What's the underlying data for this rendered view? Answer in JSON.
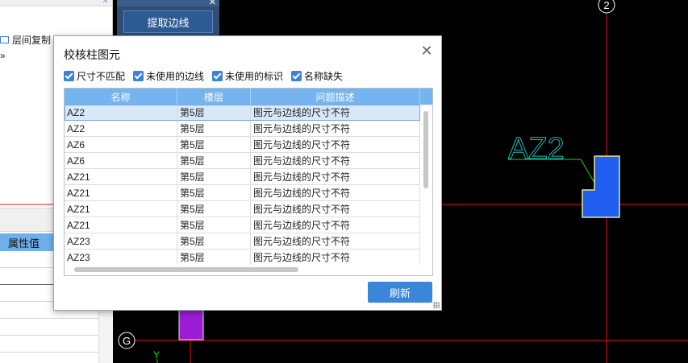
{
  "left_panel": {
    "toolbar_label": "层间复制",
    "property_value_header": "属性值"
  },
  "tool_panel": {
    "extract_button": "提取边线"
  },
  "cad": {
    "axis_top_label": "2",
    "axis_left_label": "G",
    "axis_y_label": "Y",
    "column_label": "AZ2"
  },
  "dialog": {
    "title": "校核柱图元",
    "filters": [
      {
        "label": "尺寸不匹配",
        "checked": true
      },
      {
        "label": "未使用的边线",
        "checked": true
      },
      {
        "label": "未使用的标识",
        "checked": true
      },
      {
        "label": "名称缺失",
        "checked": true
      }
    ],
    "columns": [
      "名称",
      "楼层",
      "问题描述"
    ],
    "rows": [
      {
        "name": "AZ2",
        "floor": "第5层",
        "desc": "图元与边线的尺寸不符"
      },
      {
        "name": "AZ2",
        "floor": "第5层",
        "desc": "图元与边线的尺寸不符"
      },
      {
        "name": "AZ6",
        "floor": "第5层",
        "desc": "图元与边线的尺寸不符"
      },
      {
        "name": "AZ6",
        "floor": "第5层",
        "desc": "图元与边线的尺寸不符"
      },
      {
        "name": "AZ21",
        "floor": "第5层",
        "desc": "图元与边线的尺寸不符"
      },
      {
        "name": "AZ21",
        "floor": "第5层",
        "desc": "图元与边线的尺寸不符"
      },
      {
        "name": "AZ21",
        "floor": "第5层",
        "desc": "图元与边线的尺寸不符"
      },
      {
        "name": "AZ21",
        "floor": "第5层",
        "desc": "图元与边线的尺寸不符"
      },
      {
        "name": "AZ23",
        "floor": "第5层",
        "desc": "图元与边线的尺寸不符"
      },
      {
        "name": "AZ23",
        "floor": "第5层",
        "desc": "图元与边线的尺寸不符"
      }
    ],
    "refresh_label": "刷新",
    "close_icon": "close-icon"
  },
  "colors": {
    "accent_blue": "#3a86d8",
    "grid_header": "#75b4ee",
    "axis_red": "#e0141a",
    "column_fill": "#1f5ef0",
    "label_cyan": "#19b9b9",
    "column_purple": "#9b1bd6"
  }
}
